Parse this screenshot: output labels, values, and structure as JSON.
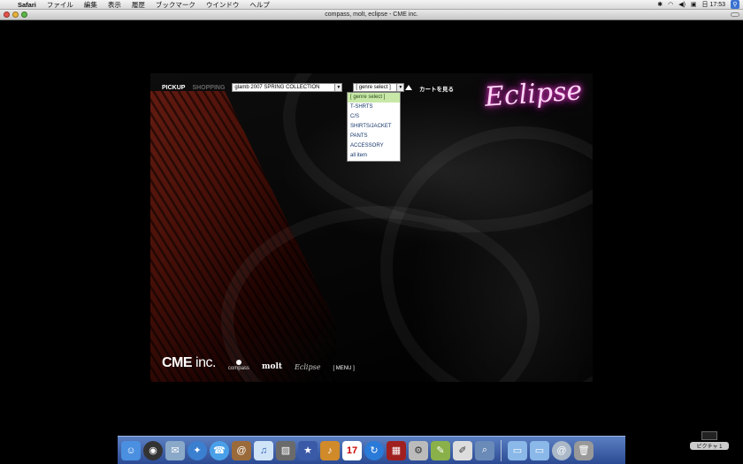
{
  "menubar": {
    "app": "Safari",
    "items": [
      "ファイル",
      "編集",
      "表示",
      "履歴",
      "ブックマーク",
      "ウインドウ",
      "ヘルプ"
    ],
    "clock": "日 17:53"
  },
  "window": {
    "title": "compass, molt, eclipse - CME inc."
  },
  "flash": {
    "nav": {
      "pickup": "PICKUP",
      "shopping": "SHOPPING"
    },
    "collection_select": {
      "value": "glamb 2007 SPRING COLLECTION"
    },
    "genre_select": {
      "value": "[ genre select ]",
      "options": [
        "[ genre select ]",
        "T-SHRTS",
        "C/S",
        "SHIRTS/JACKET",
        "PANTS",
        "ACCESSORY",
        "all item"
      ]
    },
    "cart_link": "カートを見る",
    "logo": "Eclipse",
    "footer": {
      "cme": "CME",
      "inc": "inc.",
      "compass": "compass",
      "molt": "molt",
      "eclipse": "Eclipse",
      "menu": "[ MENU ]"
    }
  },
  "dock": {
    "apps": [
      "finder-icon",
      "dashboard-icon",
      "mail-icon",
      "safari-icon",
      "ichat-icon",
      "address-book-icon",
      "itunes-icon",
      "iphoto-icon",
      "imovie-icon",
      "garageband-icon",
      "ical-icon",
      "sync-icon",
      "photobooth-icon",
      "system-prefs-icon",
      "script-editor-icon",
      "textedit-icon",
      "preview-icon"
    ],
    "folders": [
      "folder-icon",
      "folder-icon",
      "mail-link-icon",
      "trash-icon"
    ]
  },
  "desktop": {
    "picture_label": "ピクチャ 1"
  }
}
